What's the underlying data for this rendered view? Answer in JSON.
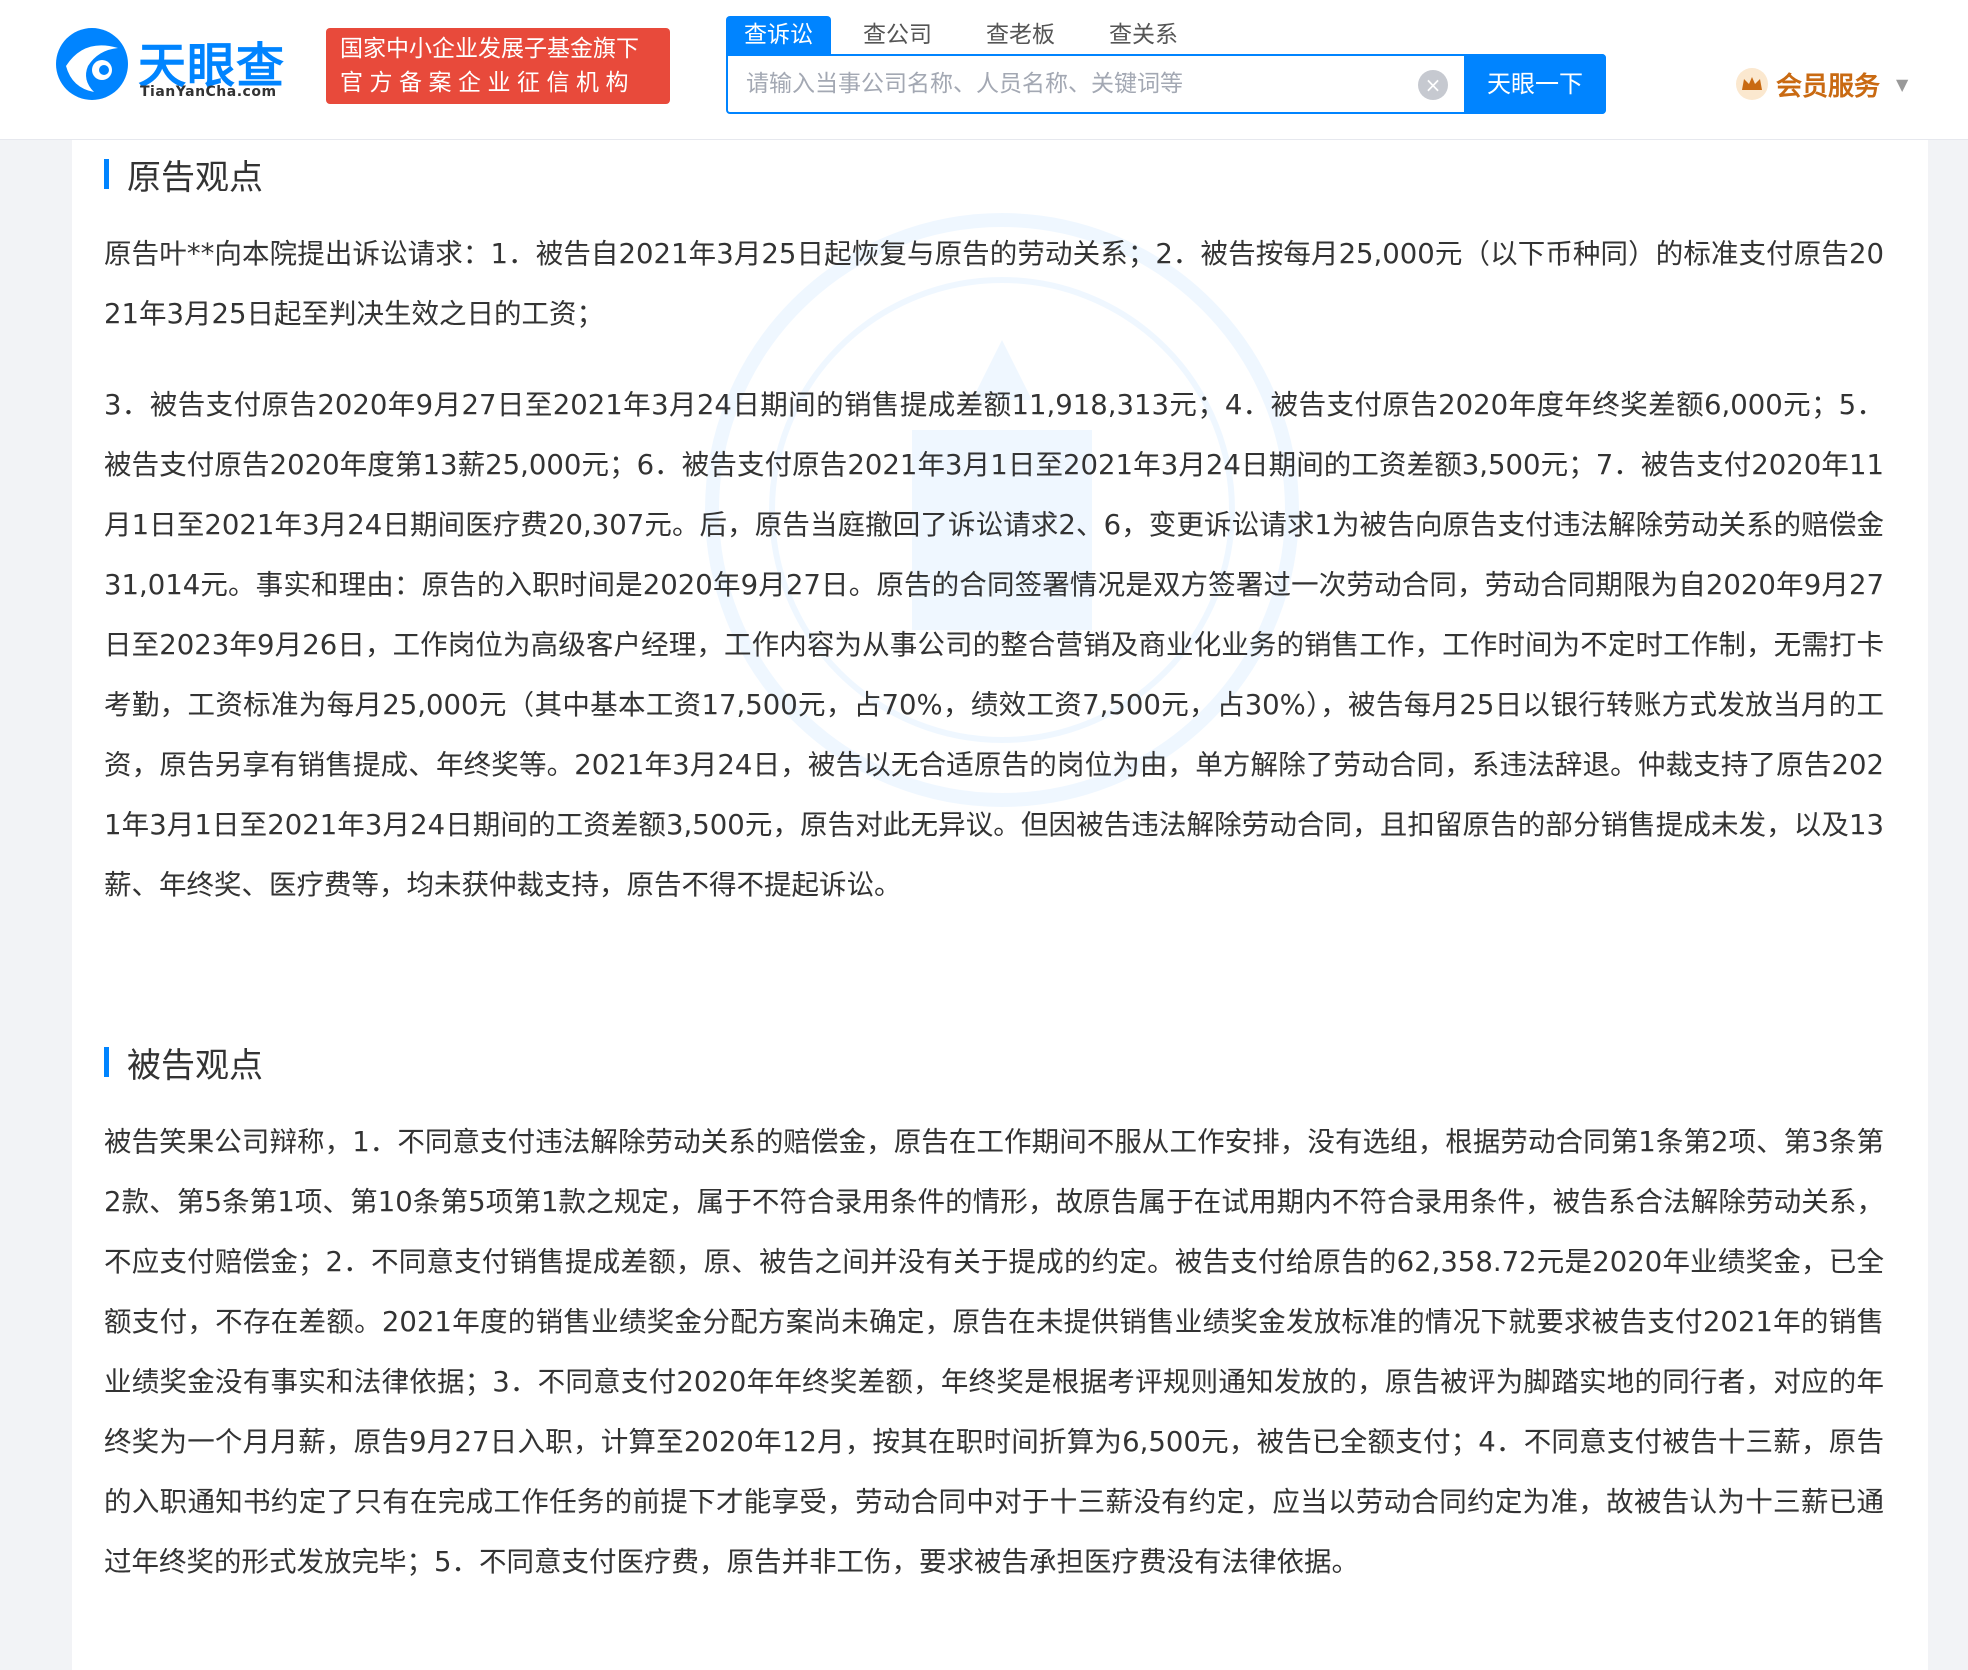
{
  "header": {
    "logo_cn": "天眼查",
    "logo_en": "TianYanCha.com",
    "badge_line1": "国家中小企业发展子基金旗下",
    "badge_line2": "官方备案企业征信机构",
    "tabs": [
      {
        "label": "查诉讼",
        "active": true
      },
      {
        "label": "查公司",
        "active": false
      },
      {
        "label": "查老板",
        "active": false
      },
      {
        "label": "查关系",
        "active": false
      }
    ],
    "search": {
      "placeholder": "请输入当事公司名称、人员名称、关键词等",
      "value": "",
      "button_label": "天眼一下"
    },
    "vip_label": "会员服务",
    "brand_color": "#0084ff",
    "badge_color": "#e84a3b",
    "icons": [
      "tianyancha-logo-icon",
      "clear-icon",
      "crown-icon",
      "caret-down-icon"
    ]
  },
  "sections": [
    {
      "title": "原告观点",
      "paragraphs": [
        "原告叶**向本院提出诉讼请求：1．被告自2021年3月25日起恢复与原告的劳动关系；2．被告按每月25,000元（以下币种同）的标准支付原告2021年3月25日起至判决生效之日的工资；",
        "3．被告支付原告2020年9月27日至2021年3月24日期间的销售提成差额11,918,313元；4．被告支付原告2020年度年终奖差额6,000元；5．被告支付原告2020年度第13薪25,000元；6．被告支付原告2021年3月1日至2021年3月24日期间的工资差额3,500元；7．被告支付2020年11月1日至2021年3月24日期间医疗费20,307元。后，原告当庭撤回了诉讼请求2、6，变更诉讼请求1为被告向原告支付违法解除劳动关系的赔偿金31,014元。事实和理由：原告的入职时间是2020年9月27日。原告的合同签署情况是双方签署过一次劳动合同，劳动合同期限为自2020年9月27日至2023年9月26日，工作岗位为高级客户经理，工作内容为从事公司的整合营销及商业化业务的销售工作，工作时间为不定时工作制，无需打卡考勤，工资标准为每月25,000元（其中基本工资17,500元，占70%，绩效工资7,500元，占30%），被告每月25日以银行转账方式发放当月的工资，原告另享有销售提成、年终奖等。2021年3月24日，被告以无合适原告的岗位为由，单方解除了劳动合同，系违法辞退。仲裁支持了原告2021年3月1日至2021年3月24日期间的工资差额3,500元，原告对此无异议。但因被告违法解除劳动合同，且扣留原告的部分销售提成未发，以及13薪、年终奖、医疗费等，均未获仲裁支持，原告不得不提起诉讼。"
      ]
    },
    {
      "title": "被告观点",
      "paragraphs": [
        "被告笑果公司辩称，1．不同意支付违法解除劳动关系的赔偿金，原告在工作期间不服从工作安排，没有选组，根据劳动合同第1条第2项、第3条第2款、第5条第1项、第10条第5项第1款之规定，属于不符合录用条件的情形，故原告属于在试用期内不符合录用条件，被告系合法解除劳动关系，不应支付赔偿金；2．不同意支付销售提成差额，原、被告之间并没有关于提成的约定。被告支付给原告的62,358.72元是2020年业绩奖金，已全额支付，不存在差额。2021年度的销售业绩奖金分配方案尚未确定，原告在未提供销售业绩奖金发放标准的情况下就要求被告支付2021年的销售业绩奖金没有事实和法律依据；3．不同意支付2020年年终奖差额，年终奖是根据考评规则通知发放的，原告被评为脚踏实地的同行者，对应的年终奖为一个月月薪，原告9月27日入职，计算至2020年12月，按其在职时间折算为6,500元，被告已全额支付；4．不同意支付被告十三薪，原告的入职通知书约定了只有在完成工作任务的前提下才能享受，劳动合同中对于十三薪没有约定，应当以劳动合同约定为准，故被告认为十三薪已通过年终奖的形式发放完毕；5．不同意支付医疗费，原告并非工伤，要求被告承担医疗费没有法律依据。"
      ]
    }
  ]
}
